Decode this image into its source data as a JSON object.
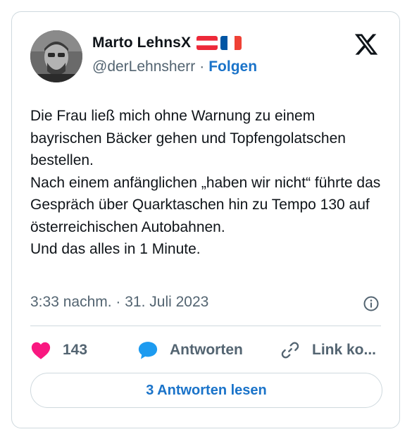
{
  "tweet": {
    "author_name": "Marto LehnsX",
    "handle": "@derLehnsherr",
    "separator": "·",
    "follow_label": "Folgen",
    "text": "Die Frau ließ mich ohne Warnung zu einem bayrischen Bäcker gehen und Topfengolatschen bestellen.\nNach einem anfänglichen „haben wir nicht“ führte das Gespräch über Quarktaschen hin zu Tempo 130 auf österreichischen Autobahnen.\nUnd das alles in 1 Minute.",
    "timestamp": "3:33 nachm. · 31. Juli 2023"
  },
  "actions": {
    "like_count": "143",
    "reply_label": "Antworten",
    "copy_link_label": "Link ko..."
  },
  "read_replies_label": "3 Antworten lesen",
  "icons": {
    "like": "heart-icon",
    "reply": "speech-bubble-icon",
    "link": "link-icon",
    "info": "info-icon",
    "logo": "x-logo-icon"
  },
  "colors": {
    "accent": "#1a73c9",
    "like": "#f91880",
    "reply": "#1d9bf0",
    "muted": "#536471",
    "border": "#cfd9de"
  }
}
